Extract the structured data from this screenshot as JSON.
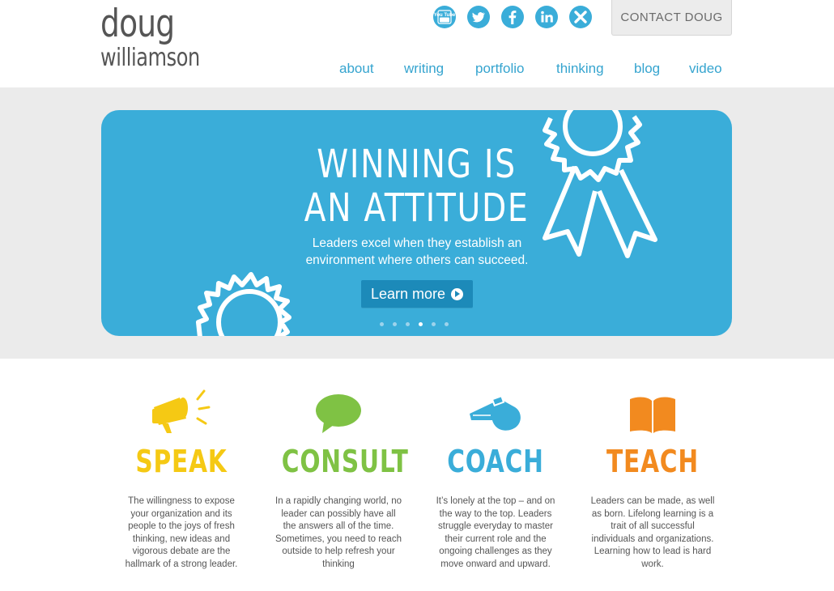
{
  "header": {
    "logo_line1": "doug",
    "logo_line2": "williamson",
    "social": [
      {
        "icon": "youtube-icon",
        "label": "You Tube"
      },
      {
        "icon": "twitter-icon"
      },
      {
        "icon": "facebook-icon"
      },
      {
        "icon": "linkedin-icon"
      },
      {
        "icon": "xing-icon"
      }
    ],
    "contact_label": "CONTACT DOUG",
    "nav": [
      "about",
      "writing",
      "portfolio",
      "thinking",
      "blog",
      "video"
    ]
  },
  "hero": {
    "title_line1": "WINNING IS",
    "title_line2": "AN ATTITUDE",
    "subtitle": "Leaders excel when they establish an environment where others can succeed.",
    "button_label": "Learn more",
    "slides": 6,
    "active_slide": 4
  },
  "services": [
    {
      "title": "SPEAK",
      "icon": "megaphone-icon",
      "color": "#f5c914",
      "description": "The willingness to expose your organization and its people to the joys of fresh thinking, new ideas and vigorous debate are the hallmark of a strong leader."
    },
    {
      "title": "CONSULT",
      "icon": "speech-bubble-icon",
      "color": "#7fc244",
      "description": "In a rapidly changing world, no leader can possibly have all the answers all of the time. Sometimes, you need to reach outside to help refresh your thinking"
    },
    {
      "title": "COACH",
      "icon": "whistle-icon",
      "color": "#3aadd9",
      "description": "It’s lonely at the top – and on the way to the top. Leaders struggle everyday to master their current role and the ongoing challenges as they move onward and upward."
    },
    {
      "title": "TEACH",
      "icon": "book-icon",
      "color": "#f28a1f",
      "description": "Leaders can be made, as well as born. Lifelong learning is a trait of all successful individuals and organizations. Learning how to lead is hard work."
    }
  ],
  "colors": {
    "accent": "#3aadd9",
    "button_dark": "#1c8ab9",
    "band": "#ebebeb",
    "text": "#555555"
  }
}
